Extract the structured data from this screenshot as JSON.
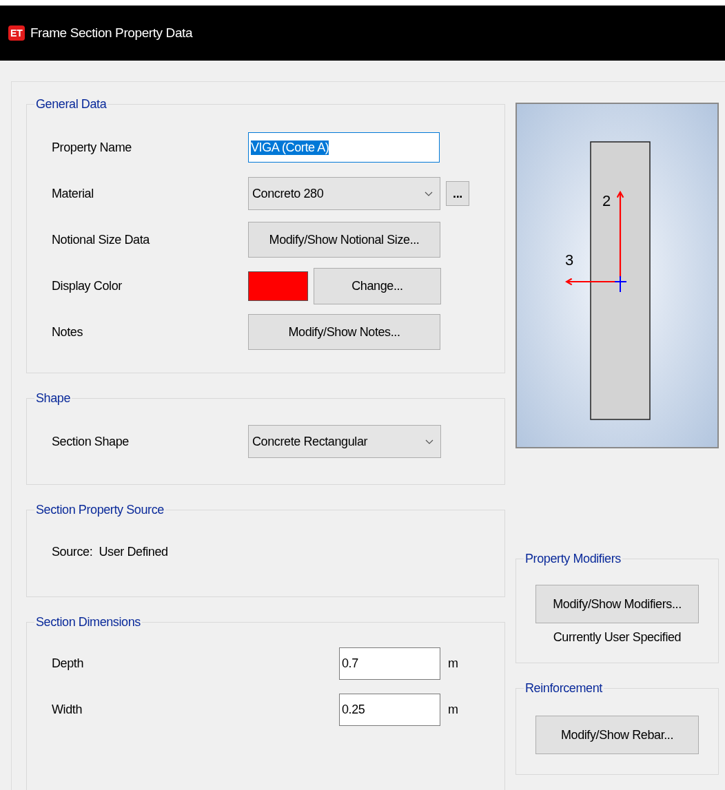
{
  "window": {
    "title": "Frame Section Property Data",
    "app_badge": "ET"
  },
  "general_data": {
    "title": "General Data",
    "property_name": {
      "label": "Property Name",
      "value": "VIGA (Corte A)",
      "text_selected": true
    },
    "material": {
      "label": "Material",
      "value": "Concreto 280",
      "browse_button": "..."
    },
    "notional_size": {
      "label": "Notional Size Data",
      "button": "Modify/Show Notional Size..."
    },
    "display_color": {
      "label": "Display Color",
      "color": "#ff0000",
      "button": "Change..."
    },
    "notes": {
      "label": "Notes",
      "button": "Modify/Show Notes..."
    }
  },
  "shape": {
    "title": "Shape",
    "section_shape": {
      "label": "Section Shape",
      "value": "Concrete Rectangular"
    }
  },
  "section_property_source": {
    "title": "Section Property Source",
    "text": "Source:  User Defined"
  },
  "section_dimensions": {
    "title": "Section Dimensions",
    "fields": [
      {
        "label": "Depth",
        "value": "0.7",
        "unit": "m"
      },
      {
        "label": "Width",
        "value": "0.25",
        "unit": "m"
      }
    ]
  },
  "preview": {
    "axis_2_label": "2",
    "axis_3_label": "3"
  },
  "property_modifiers": {
    "title": "Property Modifiers",
    "button": "Modify/Show Modifiers...",
    "status": "Currently User Specified"
  },
  "reinforcement": {
    "title": "Reinforcement",
    "button": "Modify/Show Rebar..."
  }
}
